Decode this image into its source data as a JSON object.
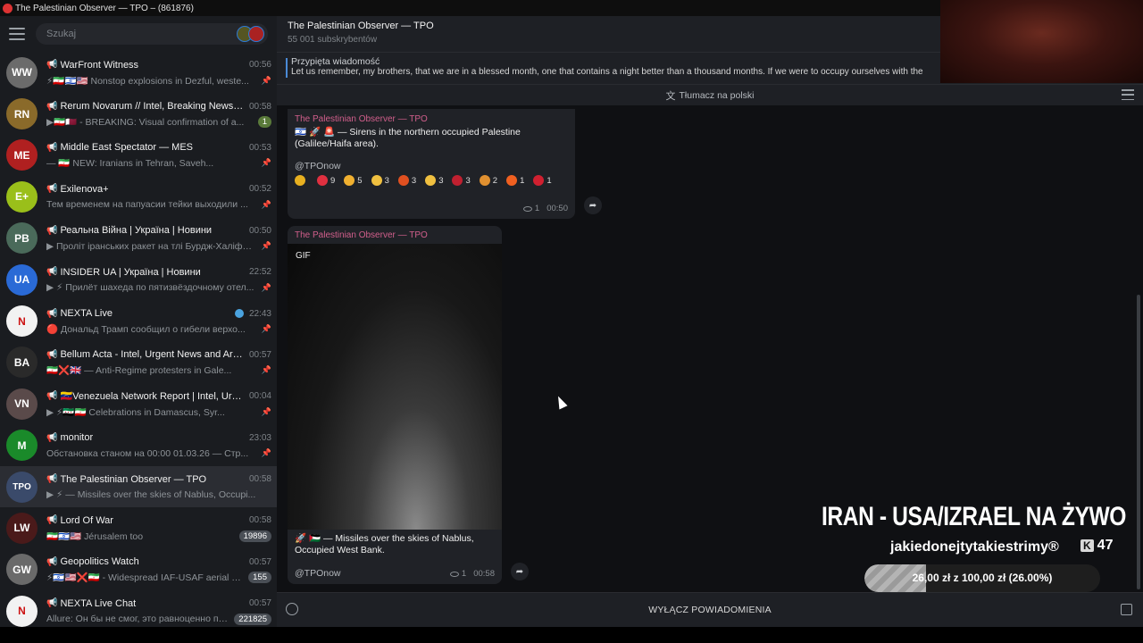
{
  "window": {
    "title": "The Palestinian Observer — TPO – (861876)"
  },
  "sidebar": {
    "search_placeholder": "Szukaj",
    "chats": [
      {
        "name": "WarFront Witness",
        "time": "00:56",
        "preview": "⚡🇮🇷🇮🇱🇺🇸 Nonstop explosions in Dezful, weste...",
        "pinned": true,
        "avatar_color": "#6b6b6b",
        "avatar_text": "WW"
      },
      {
        "name": "Rerum Novarum // Intel, Breaking News, an...",
        "time": "00:58",
        "preview": "▶🇮🇷🇶🇦 - BREAKING: Visual confirmation of a...",
        "badge": "1",
        "avatar_color": "#8a6a2a",
        "avatar_text": "RN"
      },
      {
        "name": "Middle East Spectator — MES",
        "time": "00:53",
        "preview": "— 🇮🇷 NEW: Iranians in Tehran, Saveh...",
        "pinned": true,
        "avatar_color": "#b02020",
        "avatar_text": "ME"
      },
      {
        "name": "Exilenova+",
        "time": "00:52",
        "preview": "Тем временем на папуасии тейки выходили ...",
        "pinned": true,
        "avatar_color": "#9abf1a",
        "avatar_text": "E+"
      },
      {
        "name": "Реальна Війна | Україна | Новини",
        "time": "00:50",
        "preview": "▶ Проліт іранських ракет на тлі Бурдж-Халіфи ...",
        "pinned": true,
        "avatar_color": "#4a6a5a",
        "avatar_text": "РВ"
      },
      {
        "name": "INSIDER UA | Україна | Новини",
        "time": "22:52",
        "preview": "▶ ⚡ Прилёт шахеда по пятизвёздочному отел...",
        "pinned": true,
        "avatar_color": "#2a6ad6",
        "avatar_text": "UA"
      },
      {
        "name": "NEXTA Live",
        "time": "22:43",
        "preview": "🔴 Дональд Трамп сообщил о гибели верхо...",
        "pinned": true,
        "verified": true,
        "avatar_color": "#f2f2f2",
        "avatar_text": "N"
      },
      {
        "name": "Bellum Acta - Intel, Urgent News and Archiv...",
        "time": "00:57",
        "preview": "🇮🇷❌🇬🇧 — Anti-Regime protesters in Gale...",
        "pinned": true,
        "avatar_color": "#2a2a2a",
        "avatar_text": "BA"
      },
      {
        "name": "🇻🇪Venezuela Network Report | Intel, Urgen...",
        "time": "00:04",
        "preview": "▶ ⚡🇸🇾🇮🇷 Celebrations in Damascus, Syr...",
        "pinned": true,
        "avatar_color": "#5a4a4a",
        "avatar_text": "VN"
      },
      {
        "name": "monitor",
        "time": "23:03",
        "preview": "Обстановка станом на 00:00 01.03.26 — Стр...",
        "pinned": true,
        "avatar_color": "#1a8a2a",
        "avatar_text": "M"
      },
      {
        "name": "The Palestinian Observer — TPO",
        "time": "00:58",
        "preview": "▶ ⚡ — Missiles over the skies of Nablus, Occupi...",
        "active": true,
        "avatar_color": "#3a4a6a",
        "avatar_text": "TPO"
      },
      {
        "name": "Lord Of War",
        "time": "00:58",
        "preview": "🇮🇷🇮🇱🇺🇸 Jérusalem too",
        "badge": "19896",
        "badge_grey": true,
        "avatar_color": "#4a1a1a",
        "avatar_text": "LW"
      },
      {
        "name": "Geopolitics Watch",
        "time": "00:57",
        "preview": "⚡🇮🇱🇺🇸❌🇮🇷 - Widespread IAF-USAF aerial so...",
        "badge": "155",
        "badge_grey": true,
        "avatar_color": "#6a6a6a",
        "avatar_text": "GW"
      },
      {
        "name": "NEXTA Live Chat",
        "time": "00:57",
        "preview": "Allure: Он бы не смог, это равноценно поли...",
        "badge": "221825",
        "badge_grey": true,
        "avatar_color": "#f2f2f2",
        "avatar_text": "N"
      }
    ]
  },
  "header": {
    "channel_name": "The Palestinian Observer — TPO",
    "subscribers": "55 001 subskrybentów"
  },
  "pinned": {
    "label": "Przypięta wiadomość",
    "text": "Let us remember, my brothers, that we are in a blessed month, one that contains a night better than a thousand months. If we were to occupy ourselves with the"
  },
  "translate": {
    "label": "Tłumacz na polski"
  },
  "messages": [
    {
      "sender": "The Palestinian Observer — TPO",
      "text": "🇮🇱 🚀 🚨 — Sirens in the northern occupied Palestine (Galilee/Haifa area).",
      "link": "@TPOnow",
      "reactions": [
        {
          "emoji": "⭐",
          "count": "",
          "color": "#e8b020"
        },
        {
          "emoji": "❤",
          "count": "9",
          "color": "#e03040"
        },
        {
          "emoji": "😍",
          "count": "5",
          "color": "#f0b030"
        },
        {
          "emoji": "👍",
          "count": "3",
          "color": "#f0c040"
        },
        {
          "emoji": "🤬",
          "count": "3",
          "color": "#e05020"
        },
        {
          "emoji": "😁",
          "count": "3",
          "color": "#f0c040"
        },
        {
          "emoji": "💔",
          "count": "3",
          "color": "#c02030"
        },
        {
          "emoji": "🎉",
          "count": "2",
          "color": "#e09030"
        },
        {
          "emoji": "🔥",
          "count": "1",
          "color": "#f06020"
        },
        {
          "emoji": "🍓",
          "count": "1",
          "color": "#d02030"
        }
      ],
      "views": "1",
      "time": "00:50"
    },
    {
      "sender": "The Palestinian Observer — TPO",
      "media_label": "GIF",
      "text": "🚀 🇵🇸 — Missiles over the skies of Nablus, Occupied West Bank.",
      "link": "@TPOnow",
      "views": "1",
      "time": "00:58"
    }
  ],
  "composer": {
    "label": "WYŁĄCZ POWIADOMIENIA"
  },
  "overlay": {
    "title": "IRAN - USA/IZRAEL NA ŻYWO",
    "channel": "jakiedonejtytakiestrimy®",
    "kick_label": "K",
    "viewers": "47",
    "donation_text": "26,00 zł z 100,00 zł (26.00%)",
    "donation_progress": 0.26
  }
}
